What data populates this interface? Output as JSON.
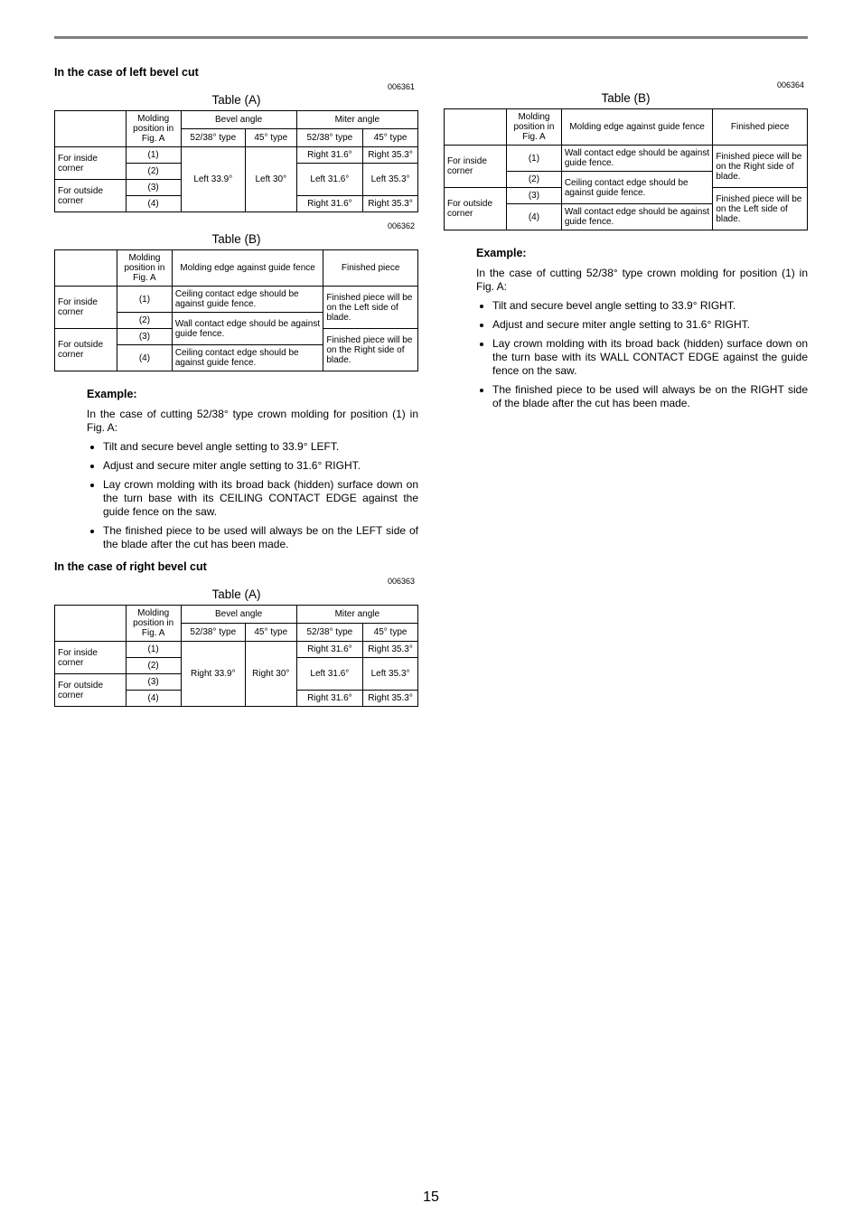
{
  "page_number": "15",
  "left": {
    "heading_left_bevel": "In the case of left bevel cut",
    "code_a": "006361",
    "table_a_title": "Table (A)",
    "ta": {
      "molding_h1": "Molding position in Fig. A",
      "bevel_h": "Bevel angle",
      "miter_h": "Miter angle",
      "bevel_5238": "52/38° type",
      "bevel_45": "45° type",
      "miter_5238": "52/38° type",
      "miter_45": "45° type",
      "r1": "For inside corner",
      "r2": "For outside corner",
      "p1": "(1)",
      "p2": "(2)",
      "p3": "(3)",
      "p4": "(4)",
      "bevel_left339": "Left 33.9°",
      "bevel_left30": "Left 30°",
      "m1_5238": "Right 31.6°",
      "m1_45": "Right 35.3°",
      "m2_5238": "Left 31.6°",
      "m2_45": "Left 35.3°",
      "m4_5238": "Right 31.6°",
      "m4_45": "Right 35.3°"
    },
    "code_b": "006362",
    "table_b_title": "Table (B)",
    "tb": {
      "h_pos": "Molding position in Fig. A",
      "h_edge": "Molding edge against guide fence",
      "h_fin": "Finished piece",
      "inside": "For inside corner",
      "outside": "For outside corner",
      "p1": "(1)",
      "p2": "(2)",
      "p3": "(3)",
      "p4": "(4)",
      "e1": "Ceiling contact edge should be against guide fence.",
      "e2": "Wall contact edge should be against guide fence.",
      "e4": "Ceiling contact edge should be against guide fence.",
      "f1": "Finished piece will be on the Left side of blade.",
      "f3": "Finished piece will be on the Right side of blade."
    },
    "example_heading": "Example:",
    "example_intro": "In the case of cutting 52/38° type crown molding for position (1) in Fig. A:",
    "bullets": [
      "Tilt and secure bevel angle setting to 33.9° LEFT.",
      "Adjust and secure miter angle setting to 31.6° RIGHT.",
      "Lay crown molding with its broad back (hidden) surface down on the turn base with its CEILING CONTACT EDGE against the guide fence on the saw.",
      "The finished piece to be used will always be on the LEFT side of the blade after the cut has been made."
    ],
    "heading_right_bevel": "In the case of right bevel cut",
    "code_a2": "006363",
    "table_a2_title": "Table (A)",
    "ta2": {
      "molding_h1": "Molding position in Fig. A",
      "bevel_h": "Bevel angle",
      "miter_h": "Miter angle",
      "bevel_5238": "52/38° type",
      "bevel_45": "45° type",
      "miter_5238": "52/38° type",
      "miter_45": "45° type",
      "r1": "For inside corner",
      "r2": "For outside corner",
      "p1": "(1)",
      "p2": "(2)",
      "p3": "(3)",
      "p4": "(4)",
      "bevel_right339": "Right 33.9°",
      "bevel_right30": "Right 30°",
      "m1_5238": "Right 31.6°",
      "m1_45": "Right 35.3°",
      "m2_5238": "Left 31.6°",
      "m2_45": "Left 35.3°",
      "m4_5238": "Right 31.6°",
      "m4_45": "Right 35.3°"
    }
  },
  "right": {
    "code_b": "006364",
    "table_b_title": "Table (B)",
    "tb": {
      "h_pos": "Molding position in Fig. A",
      "h_edge": "Molding edge against guide fence",
      "h_fin": "Finished piece",
      "inside": "For inside corner",
      "outside": "For outside corner",
      "p1": "(1)",
      "p2": "(2)",
      "p3": "(3)",
      "p4": "(4)",
      "e1": "Wall contact edge should be against guide fence.",
      "e2": "Ceiling contact edge should be against guide fence.",
      "e4": "Wall contact edge should be against guide fence.",
      "f1": "Finished piece will be on the Right side of blade.",
      "f3": "Finished piece will be on the Left side of blade."
    },
    "example_heading": "Example:",
    "example_intro": "In the case of cutting 52/38° type crown molding for position (1) in Fig. A:",
    "bullets": [
      "Tilt and secure bevel angle setting to 33.9° RIGHT.",
      "Adjust and secure miter angle setting to 31.6° RIGHT.",
      "Lay crown molding with its broad back (hidden) surface down on the turn base with its WALL CONTACT EDGE against the guide fence on the saw.",
      "The finished piece to be used will always be on the RIGHT side of the blade after the cut has been made."
    ]
  }
}
